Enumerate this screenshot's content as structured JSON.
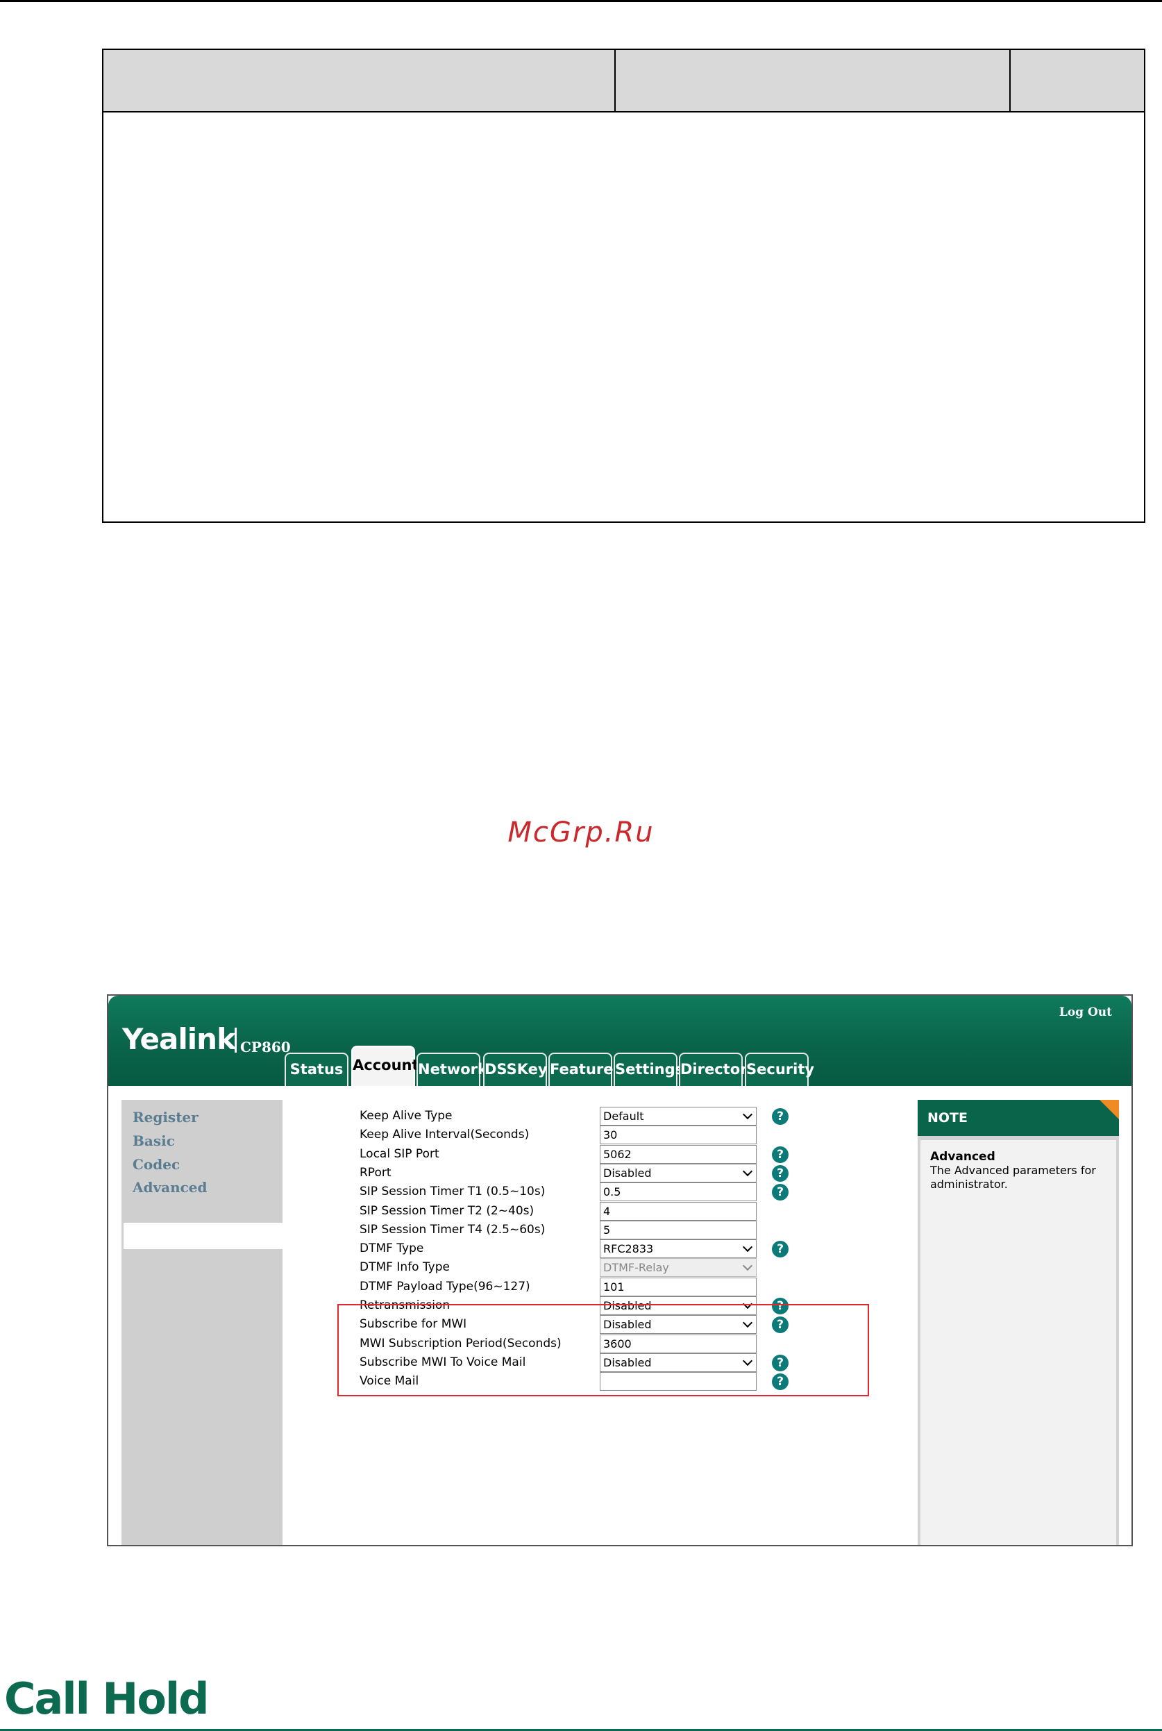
{
  "watermark": "McGrp.Ru",
  "screenshot": {
    "brand": "Yealink",
    "model": "CP860",
    "logout": "Log Out",
    "tabs": [
      "Status",
      "Account",
      "Network",
      "DSSKey",
      "Features",
      "Settings",
      "Directory",
      "Security"
    ],
    "active_tab": "Account",
    "sidebar": [
      "Register",
      "Basic",
      "Codec",
      "Advanced"
    ],
    "active_sidebar": "Advanced",
    "rows": [
      {
        "label": "Keep Alive Type",
        "value": "Default",
        "kind": "select",
        "help": true
      },
      {
        "label": "Keep Alive Interval(Seconds)",
        "value": "30",
        "kind": "text",
        "help": false
      },
      {
        "label": "Local SIP Port",
        "value": "5062",
        "kind": "text",
        "help": true
      },
      {
        "label": "RPort",
        "value": "Disabled",
        "kind": "select",
        "help": true
      },
      {
        "label": "SIP Session Timer T1 (0.5~10s)",
        "value": "0.5",
        "kind": "text",
        "help": true
      },
      {
        "label": "SIP Session Timer T2 (2~40s)",
        "value": "4",
        "kind": "text",
        "help": false
      },
      {
        "label": "SIP Session Timer T4 (2.5~60s)",
        "value": "5",
        "kind": "text",
        "help": false
      },
      {
        "label": "DTMF Type",
        "value": "RFC2833",
        "kind": "select",
        "help": true
      },
      {
        "label": "DTMF Info Type",
        "value": "DTMF-Relay",
        "kind": "select-disabled",
        "help": false
      },
      {
        "label": "DTMF Payload Type(96~127)",
        "value": "101",
        "kind": "text",
        "help": false
      },
      {
        "label": "Retransmission",
        "value": "Disabled",
        "kind": "select",
        "help": true
      },
      {
        "label": "Subscribe for MWI",
        "value": "Disabled",
        "kind": "select",
        "help": true
      },
      {
        "label": "MWI Subscription Period(Seconds)",
        "value": "3600",
        "kind": "text",
        "help": false
      },
      {
        "label": "Subscribe MWI To Voice Mail",
        "value": "Disabled",
        "kind": "select",
        "help": true
      },
      {
        "label": "Voice Mail",
        "value": "",
        "kind": "text",
        "help": true
      }
    ],
    "help_glyph": "?",
    "note": {
      "heading": "NOTE",
      "title": "Advanced",
      "text": "The Advanced parameters for administrator."
    },
    "colors": {
      "brand_green": "#0a6449",
      "highlight_red": "#e2282f",
      "note_corner": "#f08a24"
    }
  },
  "section_heading": "Call Hold"
}
